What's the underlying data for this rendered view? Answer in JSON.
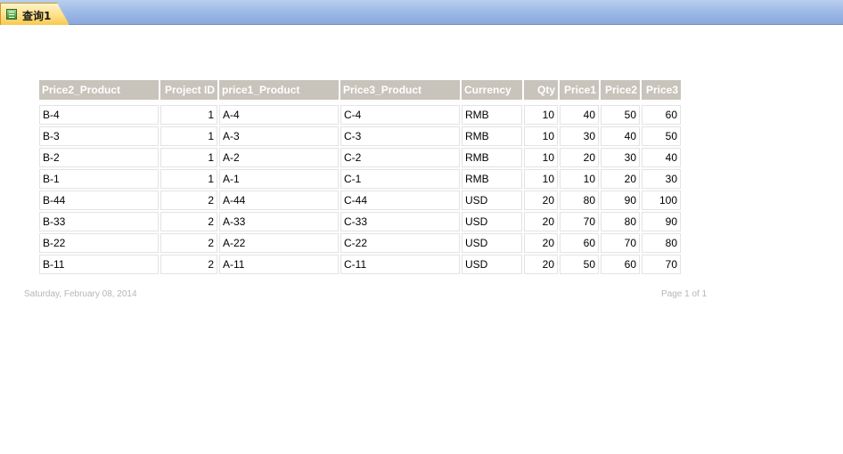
{
  "tab": {
    "label": "查询1",
    "icon": "query-icon"
  },
  "table": {
    "headers": [
      "Price2_Product",
      "Project ID",
      "price1_Product",
      "Price3_Product",
      "Currency",
      "Qty",
      "Price1",
      "Price2",
      "Price3"
    ],
    "rows": [
      [
        "B-4",
        "1",
        "A-4",
        "C-4",
        "RMB",
        "10",
        "40",
        "50",
        "60"
      ],
      [
        "B-3",
        "1",
        "A-3",
        "C-3",
        "RMB",
        "10",
        "30",
        "40",
        "50"
      ],
      [
        "B-2",
        "1",
        "A-2",
        "C-2",
        "RMB",
        "10",
        "20",
        "30",
        "40"
      ],
      [
        "B-1",
        "1",
        "A-1",
        "C-1",
        "RMB",
        "10",
        "10",
        "20",
        "30"
      ],
      [
        "B-44",
        "2",
        "A-44",
        "C-44",
        "USD",
        "20",
        "80",
        "90",
        "100"
      ],
      [
        "B-33",
        "2",
        "A-33",
        "C-33",
        "USD",
        "20",
        "70",
        "80",
        "90"
      ],
      [
        "B-22",
        "2",
        "A-22",
        "C-22",
        "USD",
        "20",
        "60",
        "70",
        "80"
      ],
      [
        "B-11",
        "2",
        "A-11",
        "C-11",
        "USD",
        "20",
        "50",
        "60",
        "70"
      ]
    ]
  },
  "footer": {
    "date": "Saturday, February 08, 2014",
    "page": "Page 1 of 1"
  },
  "colors": {
    "tab_bar": "#9fbbe6",
    "active_tab": "#ffe08a",
    "header_bg": "#c8c4bc",
    "header_text": "#ffffff",
    "footer_text": "#b6b6b6"
  }
}
